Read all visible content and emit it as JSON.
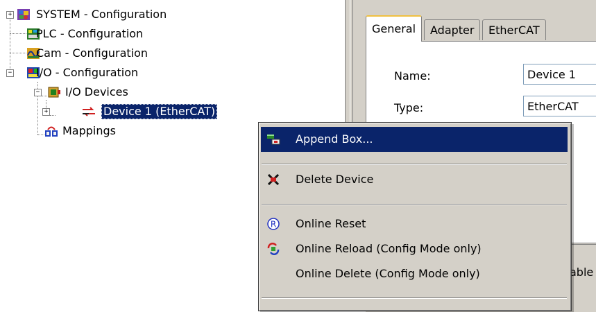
{
  "tree": {
    "items": [
      {
        "label": "SYSTEM - Configuration",
        "icon": "system-config-icon",
        "expander": "+"
      },
      {
        "label": "PLC - Configuration",
        "icon": "plc-config-icon"
      },
      {
        "label": "Cam - Configuration",
        "icon": "cam-config-icon"
      },
      {
        "label": "I/O - Configuration",
        "icon": "io-config-icon",
        "expander": "−"
      },
      {
        "label": "I/O Devices",
        "icon": "io-devices-icon",
        "expander": "−"
      },
      {
        "label": "Device 1 (EtherCAT)",
        "icon": "ethercat-device-icon",
        "expander": "+",
        "selected": true
      },
      {
        "label": "Mappings",
        "icon": "mappings-icon"
      }
    ]
  },
  "panel": {
    "tabs": [
      {
        "label": "General",
        "active": true
      },
      {
        "label": "Adapter"
      },
      {
        "label": "EtherCAT"
      }
    ],
    "fields": [
      {
        "label": "Name:",
        "value": "Device 1"
      },
      {
        "label": "Type:",
        "value": "EtherCAT"
      }
    ],
    "clipped_text": "able"
  },
  "context_menu": {
    "items": [
      {
        "label": "Append Box...",
        "icon": "append-box-icon",
        "highlighted": true
      },
      {
        "label": "Delete Device",
        "icon": "delete-device-icon"
      },
      {
        "label": "Online Reset",
        "icon": "online-reset-icon"
      },
      {
        "label": "Online Reload (Config Mode only)",
        "icon": "online-reload-icon"
      },
      {
        "label": "Online Delete (Config Mode only)",
        "icon": ""
      }
    ]
  },
  "colors": {
    "selection": "#0a246a",
    "menu_bg": "#d4d0c8",
    "tab_accent": "#f0c040"
  }
}
